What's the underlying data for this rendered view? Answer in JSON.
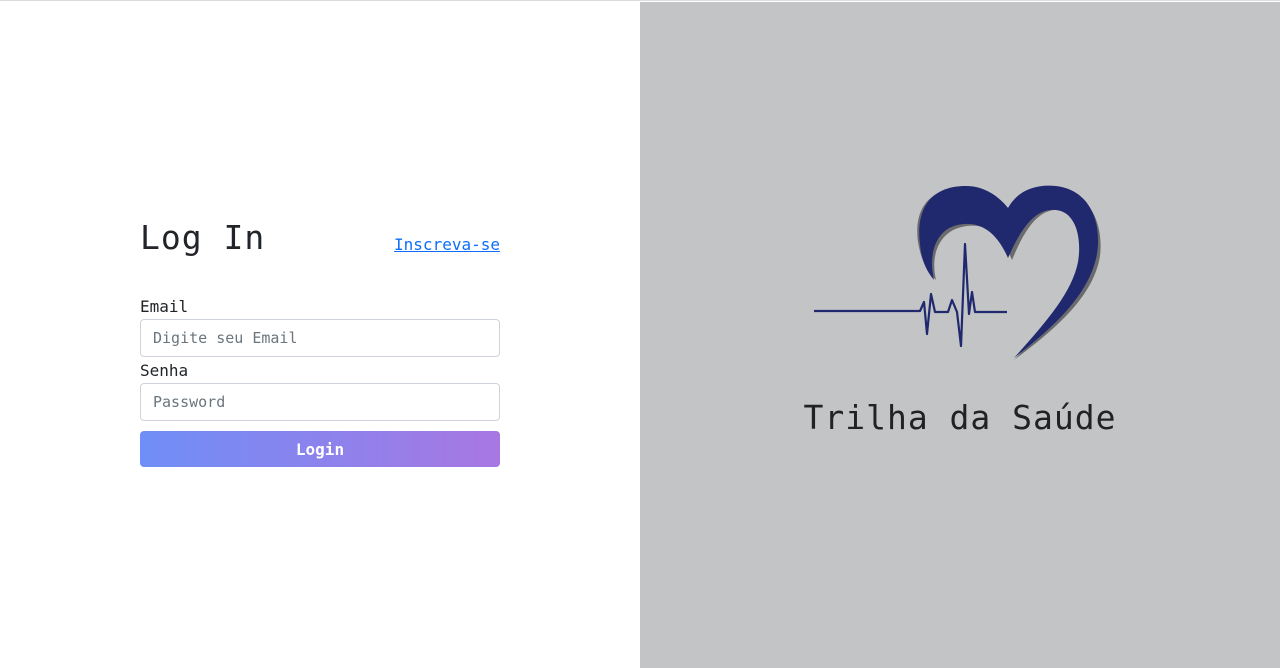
{
  "login": {
    "title": "Log In",
    "signup_link": "Inscreva-se",
    "email_label": "Email",
    "email_placeholder": "Digite seu Email",
    "email_value": "",
    "password_label": "Senha",
    "password_placeholder": "Password",
    "password_value": "",
    "submit_label": "Login"
  },
  "brand": {
    "name": "Trilha da Saúde",
    "logo_icon": "heart-pulse-icon"
  },
  "colors": {
    "logo_blue": "#20286e",
    "right_panel_bg": "#c3c4c6",
    "button_gradient_start": "#6f8ef7",
    "button_gradient_end": "#a877e2",
    "link": "#0d6efd"
  }
}
